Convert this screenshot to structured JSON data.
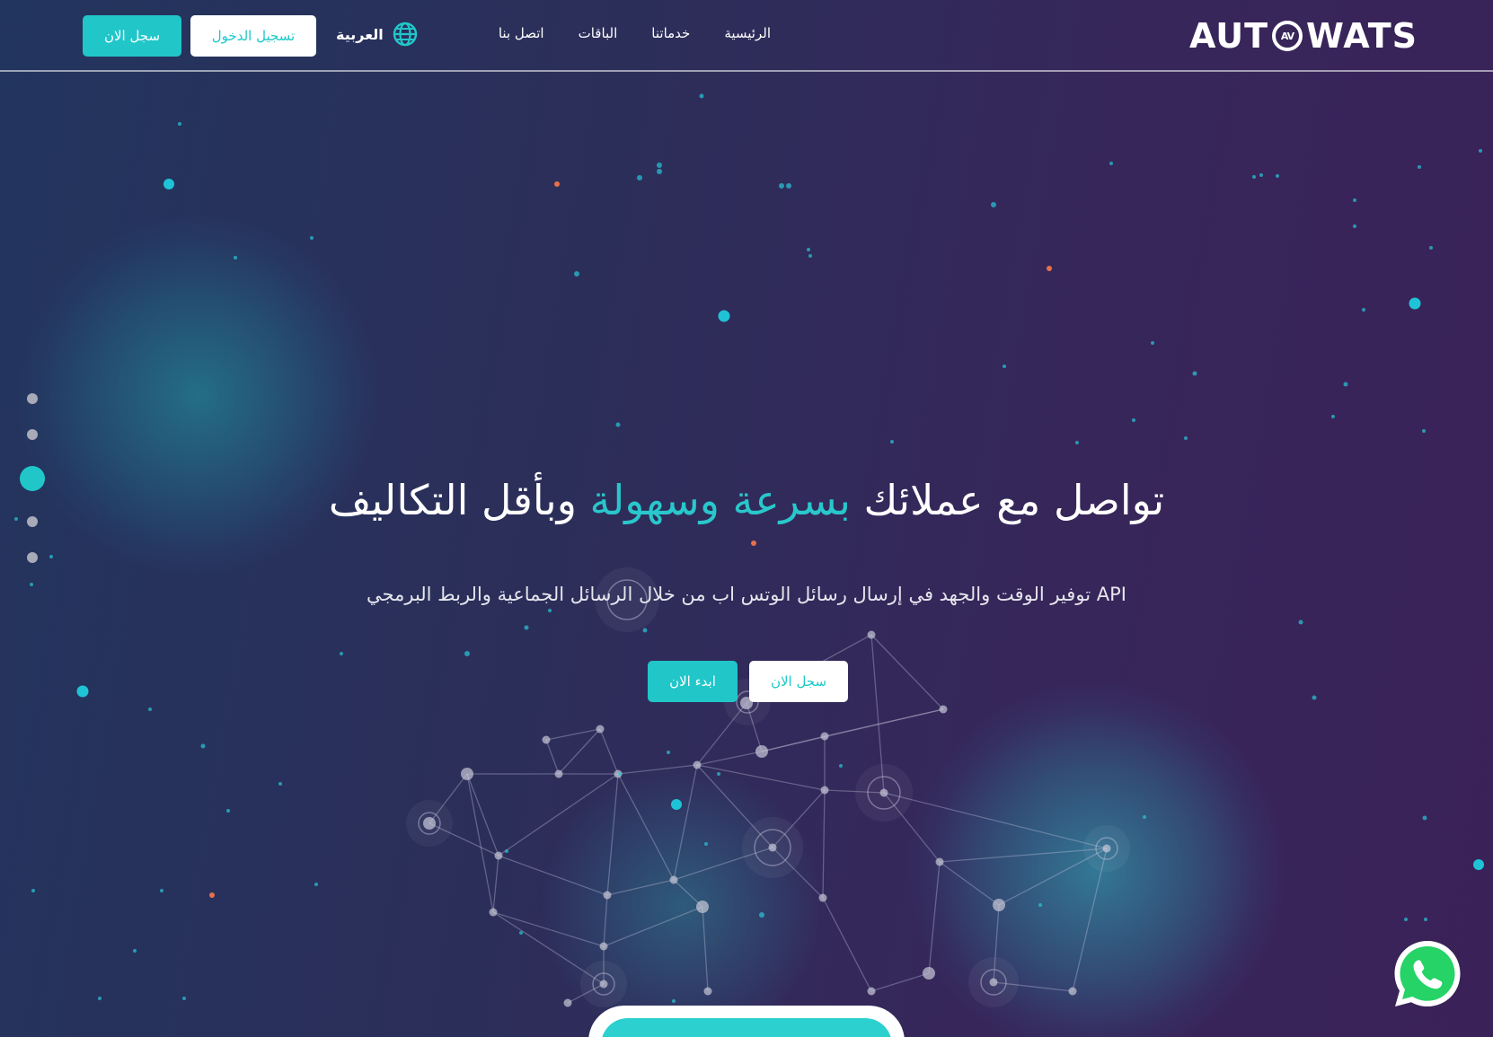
{
  "colors": {
    "accent": "#21c6c9",
    "accent_text": "#29c7cb",
    "background_start": "#22355e",
    "background_end": "#3a2258",
    "dot_cyan": "#1fc3d6",
    "dot_orange": "#e8704a",
    "whatsapp_green": "#25d366"
  },
  "header": {
    "logo_left": "AUT",
    "logo_mark": "AV",
    "logo_right": "WATS",
    "nav": [
      "الرئيسية",
      "خدماتنا",
      "الباقات",
      "اتصل بنا"
    ],
    "language_label": "العربية",
    "language_icon": "globe-icon",
    "login_label": "تسجيل الدخول",
    "register_label": "سجل الان"
  },
  "hero": {
    "title_part1": "تواصل مع عملائك",
    "title_accent": "بسرعة وسهولة",
    "title_part2": "وبأقل التكاليف",
    "subtitle": "API توفير الوقت والجهد في إرسال رسائل الوتس اب من خلال الرسائل الجماعية والربط البرمجي",
    "start_label": "ابدء الان",
    "register_label": "سجل الان"
  },
  "side_nav": {
    "dot_count": 5,
    "active_index": 2
  },
  "floating": {
    "whatsapp_icon": "whatsapp-icon"
  }
}
